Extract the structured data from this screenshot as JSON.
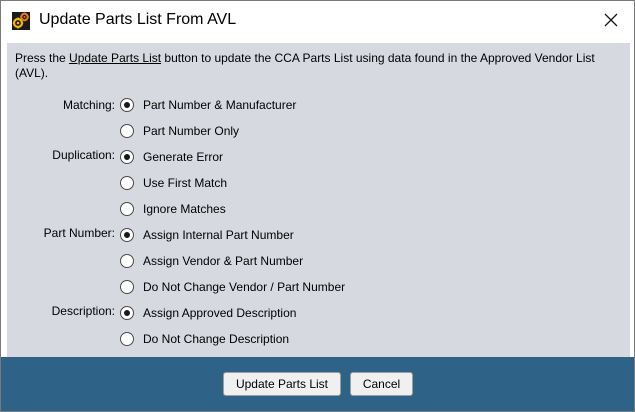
{
  "window": {
    "title": "Update Parts List From AVL",
    "close_icon": "close-icon",
    "app_icon": "gear-app-icon"
  },
  "instructions": {
    "prefix": "Press the ",
    "link": "Update Parts List",
    "suffix": " button to update the CCA Parts List using data found in the Approved Vendor List (AVL)."
  },
  "groups": {
    "matching": {
      "label": "Matching:",
      "options": [
        "Part Number & Manufacturer",
        "Part Number Only"
      ],
      "selected": "Part Number & Manufacturer"
    },
    "duplication": {
      "label": "Duplication:",
      "options": [
        "Generate Error",
        "Use First Match",
        "Ignore Matches"
      ],
      "selected": "Generate Error"
    },
    "part_number": {
      "label": "Part Number:",
      "options": [
        "Assign Internal Part Number",
        "Assign Vendor & Part Number",
        "Do Not Change Vendor / Part Number"
      ],
      "selected": "Assign Internal Part Number"
    },
    "description": {
      "label": "Description:",
      "options": [
        "Assign Approved Description",
        "Do Not Change Description"
      ],
      "selected": "Assign Approved Description"
    }
  },
  "buttons": {
    "update": "Update Parts List",
    "cancel": "Cancel"
  },
  "colors": {
    "panel": "#d6d9df",
    "footer": "#2e6286"
  }
}
